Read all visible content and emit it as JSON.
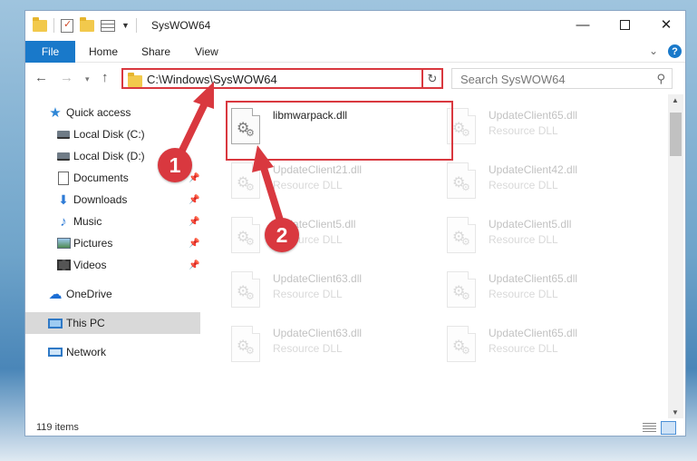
{
  "window": {
    "title": "SysWOW64",
    "controls": {
      "minimize": "—",
      "maximize": "",
      "close": "✕"
    }
  },
  "ribbon": {
    "tabs": [
      "File",
      "Home",
      "Share",
      "View"
    ],
    "expand_glyph": "⌄",
    "help_glyph": "?"
  },
  "nav": {
    "back_glyph": "←",
    "forward_glyph": "→",
    "recent_glyph": "▾",
    "up_glyph": "↑",
    "address": "C:\\Windows\\SysWOW64",
    "address_drop_glyph": "⌄",
    "refresh_glyph": "↻",
    "search_placeholder": "Search SysWOW64",
    "search_glyph": "⚲"
  },
  "sidebar": {
    "items": [
      {
        "label": "Quick access",
        "icon": "star-icon",
        "pinned": false
      },
      {
        "label": "Local Disk (C:)",
        "icon": "drive-icon",
        "pinned": true
      },
      {
        "label": "Local Disk (D:)",
        "icon": "drive-icon",
        "pinned": true
      },
      {
        "label": "Documents",
        "icon": "documents-icon",
        "pinned": true
      },
      {
        "label": "Downloads",
        "icon": "download-icon",
        "pinned": true
      },
      {
        "label": "Music",
        "icon": "music-icon",
        "pinned": true
      },
      {
        "label": "Pictures",
        "icon": "pictures-icon",
        "pinned": true
      },
      {
        "label": "Videos",
        "icon": "videos-icon",
        "pinned": true
      },
      {
        "label": "OneDrive",
        "icon": "cloud-icon",
        "pinned": false
      },
      {
        "label": "This PC",
        "icon": "computer-icon",
        "pinned": false,
        "selected": true
      },
      {
        "label": "Network",
        "icon": "network-icon",
        "pinned": false
      }
    ]
  },
  "files": {
    "left": [
      {
        "name": "libmwarpack.dll",
        "type": ""
      },
      {
        "name": "UpdateClient21.dll",
        "type": "Resource DLL"
      },
      {
        "name": "UpdateClient5.dll",
        "type": "Resource DLL"
      },
      {
        "name": "UpdateClient63.dll",
        "type": "Resource DLL"
      },
      {
        "name": "UpdateClient63.dll",
        "type": "Resource DLL"
      }
    ],
    "right": [
      {
        "name": "UpdateClient65.dll",
        "type": "Resource DLL"
      },
      {
        "name": "UpdateClient42.dll",
        "type": "Resource DLL"
      },
      {
        "name": "UpdateClient5.dll",
        "type": "Resource DLL"
      },
      {
        "name": "UpdateClient65.dll",
        "type": "Resource DLL"
      },
      {
        "name": "UpdateClient65.dll",
        "type": "Resource DLL"
      }
    ]
  },
  "status": {
    "item_count": "119 items"
  },
  "annotations": {
    "step1": "1",
    "step2": "2",
    "color": "#d9383f"
  },
  "colors": {
    "accent": "#1979ca",
    "highlight": "#d9383f",
    "selected_bg": "#d9d9d9"
  }
}
